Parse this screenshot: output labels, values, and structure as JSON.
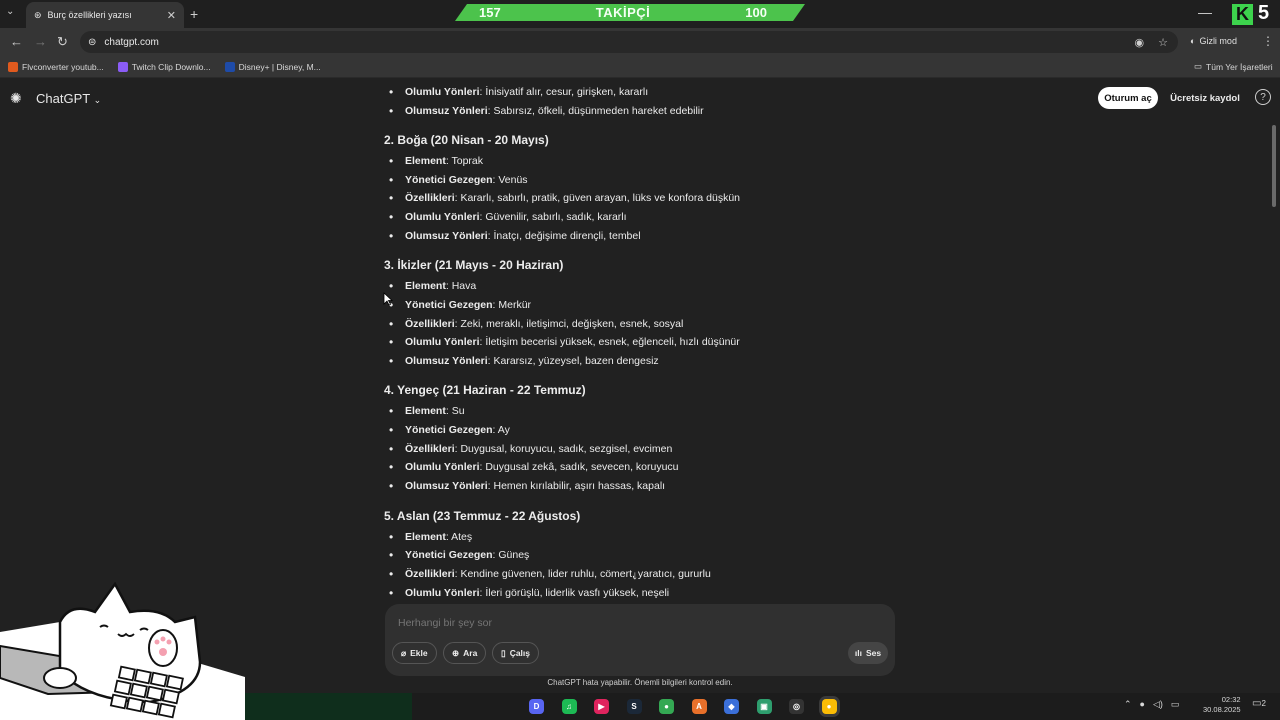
{
  "browser": {
    "tab_title": "Burç özellikleri yazısı",
    "tab_close": "✕",
    "new_tab": "+",
    "tab_list": "⌄",
    "win_minimize": "—",
    "url": "chatgpt.com",
    "incognito_label": "Gizli mod",
    "bookmarks": [
      {
        "label": "Flvconverter youtub...",
        "color": "#e05a1e"
      },
      {
        "label": "Twitch Clip Downlo...",
        "color": "#8b5cf6"
      },
      {
        "label": "Disney+ | Disney, M...",
        "color": "#1e4ba8"
      }
    ],
    "all_bookmarks": "Tüm Yer İşaretleri"
  },
  "stream_overlay": {
    "left_count": "157",
    "center_label": "TAKİPÇİ",
    "right_count": "100",
    "corner_logo": "K",
    "corner_count": "5"
  },
  "header": {
    "app_title": "ChatGPT",
    "login_label": "Oturum aç",
    "signup_label": "Ücretsiz kaydol",
    "help": "?"
  },
  "content": {
    "top_lines": [
      {
        "k": "Olumlu Yönleri",
        "v": ": İnisiyatif alır, cesur, girişken, kararlı"
      },
      {
        "k": "Olumsuz Yönleri",
        "v": ": Sabırsız, öfkeli, düşünmeden hareket edebilir"
      }
    ],
    "sections": [
      {
        "heading": "2. Boğa (20 Nisan - 20 Mayıs)",
        "items": [
          {
            "k": "Element",
            "v": ": Toprak"
          },
          {
            "k": "Yönetici Gezegen",
            "v": ": Venüs"
          },
          {
            "k": "Özellikleri",
            "v": ": Kararlı, sabırlı, pratik, güven arayan, lüks ve konfora düşkün"
          },
          {
            "k": "Olumlu Yönleri",
            "v": ": Güvenilir, sabırlı, sadık, kararlı"
          },
          {
            "k": "Olumsuz Yönleri",
            "v": ": İnatçı, değişime dirençli, tembel"
          }
        ]
      },
      {
        "heading": "3. İkizler (21 Mayıs - 20 Haziran)",
        "items": [
          {
            "k": "Element",
            "v": ": Hava"
          },
          {
            "k": "Yönetici Gezegen",
            "v": ": Merkür"
          },
          {
            "k": "Özellikleri",
            "v": ": Zeki, meraklı, iletişimci, değişken, esnek, sosyal"
          },
          {
            "k": "Olumlu Yönleri",
            "v": ": İletişim becerisi yüksek, esnek, eğlenceli, hızlı düşünür"
          },
          {
            "k": "Olumsuz Yönleri",
            "v": ": Kararsız, yüzeysel, bazen dengesiz"
          }
        ]
      },
      {
        "heading": "4. Yengeç (21 Haziran - 22 Temmuz)",
        "items": [
          {
            "k": "Element",
            "v": ": Su"
          },
          {
            "k": "Yönetici Gezegen",
            "v": ": Ay"
          },
          {
            "k": "Özellikleri",
            "v": ": Duygusal, koruyucu, sadık, sezgisel, evcimen"
          },
          {
            "k": "Olumlu Yönleri",
            "v": ": Duygusal zekâ, sadık, sevecen, koruyucu"
          },
          {
            "k": "Olumsuz Yönleri",
            "v": ": Hemen kırılabilir, aşırı hassas, kapalı"
          }
        ]
      },
      {
        "heading": "5. Aslan (23 Temmuz - 22 Ağustos)",
        "items": [
          {
            "k": "Element",
            "v": ": Ateş"
          },
          {
            "k": "Yönetici Gezegen",
            "v": ": Güneş"
          },
          {
            "k": "Özellikleri",
            "v": ": Kendine güvenen, lider ruhlu, cömert, yaratıcı, gururlu"
          },
          {
            "k": "Olumlu Yönleri",
            "v": ": İleri görüşlü, liderlik vasfı yüksek, neşeli"
          }
        ]
      }
    ]
  },
  "composer": {
    "placeholder": "Herhangi bir şey sor",
    "attach_label": "Ekle",
    "search_label": "Ara",
    "study_label": "Çalış",
    "voice_label": "Ses",
    "disclaimer": "ChatGPT hata yapabilir. Önemli bilgileri kontrol edin."
  },
  "taskbar": {
    "apps": [
      {
        "name": "discord-icon",
        "glyph": "D",
        "color": "#5865f2"
      },
      {
        "name": "spotify-icon",
        "glyph": "♫",
        "color": "#1db954"
      },
      {
        "name": "media-player-icon",
        "glyph": "▶",
        "color": "#e0245e"
      },
      {
        "name": "steam-icon",
        "glyph": "S",
        "color": "#1b2838"
      },
      {
        "name": "chrome-icon",
        "glyph": "●",
        "color": "#34a853"
      },
      {
        "name": "app-a-icon",
        "glyph": "A",
        "color": "#e8702a"
      },
      {
        "name": "app-gamepad-icon",
        "glyph": "◆",
        "color": "#3b6fd8"
      },
      {
        "name": "app-green-icon",
        "glyph": "▣",
        "color": "#2e9e6e"
      },
      {
        "name": "obs-icon",
        "glyph": "◎",
        "color": "#333333"
      },
      {
        "name": "chrome-active-icon",
        "glyph": "●",
        "color": "#fbbc05"
      }
    ],
    "time": "02:32",
    "date": "30.08.2025",
    "notifications": "2"
  },
  "colors": {
    "page_bg": "#212121",
    "follow_banner": "#4cc34c",
    "accent_green": "#3dd34d"
  }
}
